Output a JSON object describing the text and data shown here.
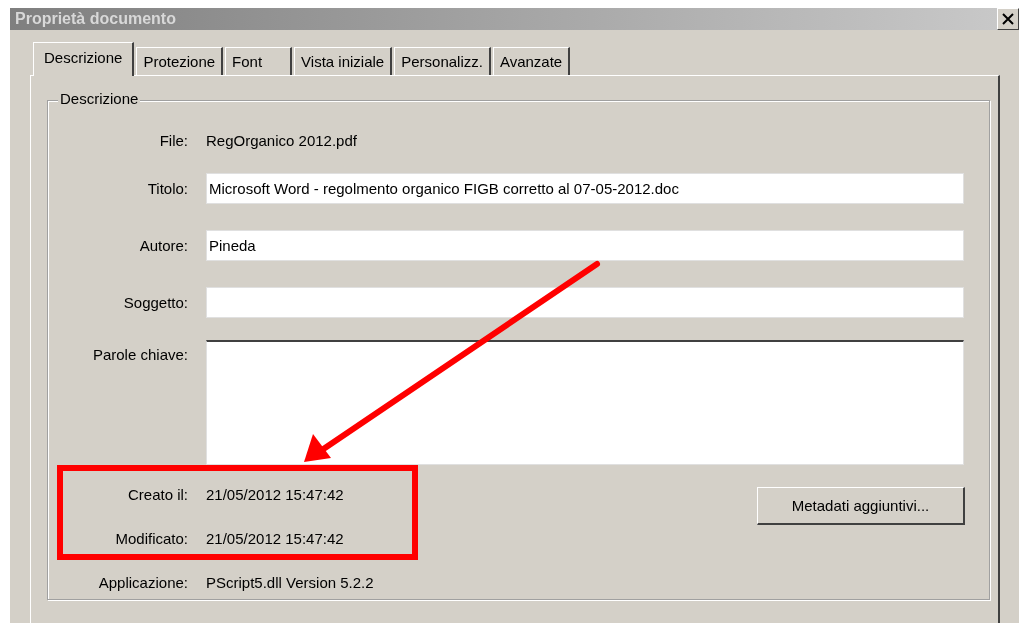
{
  "window": {
    "title": "Proprietà documento"
  },
  "tabs": [
    {
      "label": "Descrizione",
      "selected": true
    },
    {
      "label": "Protezione",
      "selected": false
    },
    {
      "label": "Font",
      "selected": false
    },
    {
      "label": "Vista iniziale",
      "selected": false
    },
    {
      "label": "Personalizz.",
      "selected": false
    },
    {
      "label": "Avanzate",
      "selected": false
    }
  ],
  "group": {
    "title": "Descrizione"
  },
  "fields": [
    {
      "kind": "static",
      "label": "File:",
      "value": "RegOrganico 2012.pdf"
    },
    {
      "kind": "input",
      "label": "Titolo:",
      "value": "Microsoft Word - regolmento organico FIGB corretto al 07-05-2012.doc"
    },
    {
      "kind": "input",
      "label": "Autore:",
      "value": "Pineda"
    },
    {
      "kind": "input",
      "label": "Soggetto:"
    },
    {
      "kind": "textarea",
      "label": "Parole chiave:"
    }
  ],
  "dates": [
    {
      "label": "Creato il:",
      "value": "21/05/2012 15:47:42"
    },
    {
      "label": "Modificato:",
      "value": "21/05/2012 15:47:42"
    }
  ],
  "application": {
    "label": "Applicazione:",
    "value": "PScript5.dll Version 5.2.2"
  },
  "button": {
    "label": "Metadati aggiuntivi..."
  }
}
